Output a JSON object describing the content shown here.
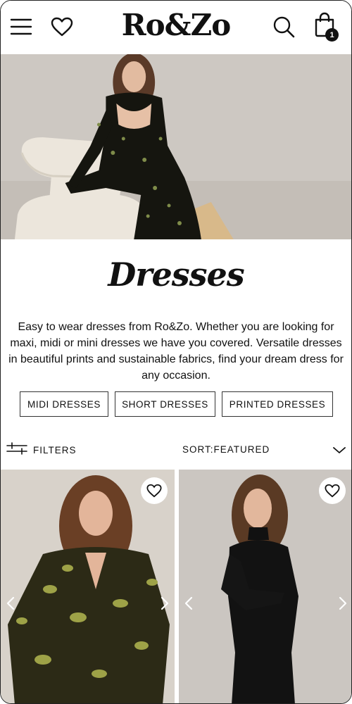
{
  "header": {
    "logo": "Ro&Zo",
    "bag_count": "1",
    "icons": [
      "menu-icon",
      "heart-icon",
      "search-icon",
      "bag-icon"
    ]
  },
  "hero": {
    "image": "model-in-black-floral-dress-on-boucle-chair"
  },
  "main": {
    "title": "Dresses",
    "intro": "Easy to wear dresses from Ro&Zo. Whether you are looking for maxi, midi or mini dresses we have you covered. Versatile dresses in beautiful prints and sustainable fabrics, find your dream dress for any occasion.",
    "chips": [
      {
        "label": "MIDI DRESSES"
      },
      {
        "label": "SHORT DRESSES"
      },
      {
        "label": "PRINTED DRESSES"
      }
    ]
  },
  "toolbar": {
    "filters_label": "FILTERS",
    "sort_label": "SORT:FEATURED"
  },
  "products": [
    {
      "image": "model-in-green-animal-print-wrap-dress",
      "wishlist_icon": "heart-icon"
    },
    {
      "image": "model-in-black-high-neck-ruched-dress",
      "wishlist_icon": "heart-icon"
    }
  ],
  "colors": {
    "text": "#111111",
    "hero_bg": "#cfcac4",
    "badge": "#111111"
  }
}
